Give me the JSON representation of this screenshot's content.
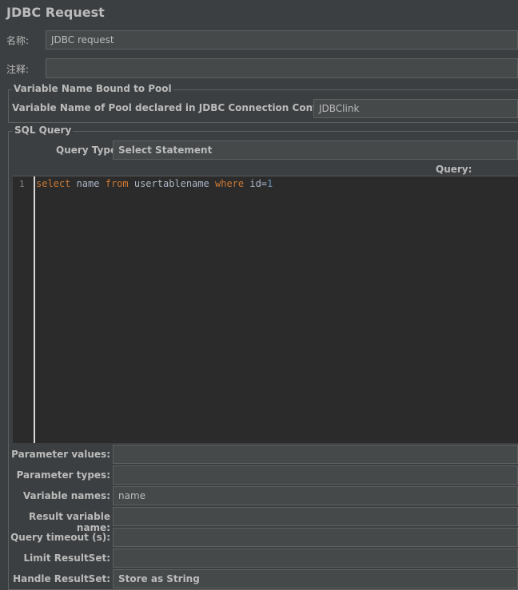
{
  "header": {
    "title": "JDBC Request"
  },
  "name_field": {
    "label": "名称:",
    "value": "JDBC request"
  },
  "comment_field": {
    "label": "注释:",
    "value": ""
  },
  "pool_group": {
    "title": "Variable Name Bound to Pool",
    "label": "Variable Name of Pool declared in JDBC Connection Configuration:",
    "value": "JDBClink"
  },
  "sql_group": {
    "title": "SQL Query",
    "query_type_label": "Query Type:",
    "query_type_value": "Select Statement",
    "query_label": "Query:"
  },
  "editor": {
    "line_number": "1",
    "tokens": {
      "t1": "select",
      "t2": " name ",
      "t3": "from",
      "t4": " usertablename ",
      "t5": "where",
      "t6": " id=",
      "t7": "1"
    },
    "colors": {
      "keyword": "#cc7832",
      "number": "#6897bb",
      "text": "#a9b7c6"
    }
  },
  "params": [
    {
      "label": "Parameter values:",
      "value": ""
    },
    {
      "label": "Parameter types:",
      "value": ""
    },
    {
      "label": "Variable names:",
      "value": "name"
    },
    {
      "label": "Result variable name:",
      "value": ""
    },
    {
      "label": "Query timeout (s):",
      "value": ""
    },
    {
      "label": "Limit ResultSet:",
      "value": ""
    },
    {
      "label": "Handle ResultSet:",
      "value": "Store as String"
    }
  ]
}
